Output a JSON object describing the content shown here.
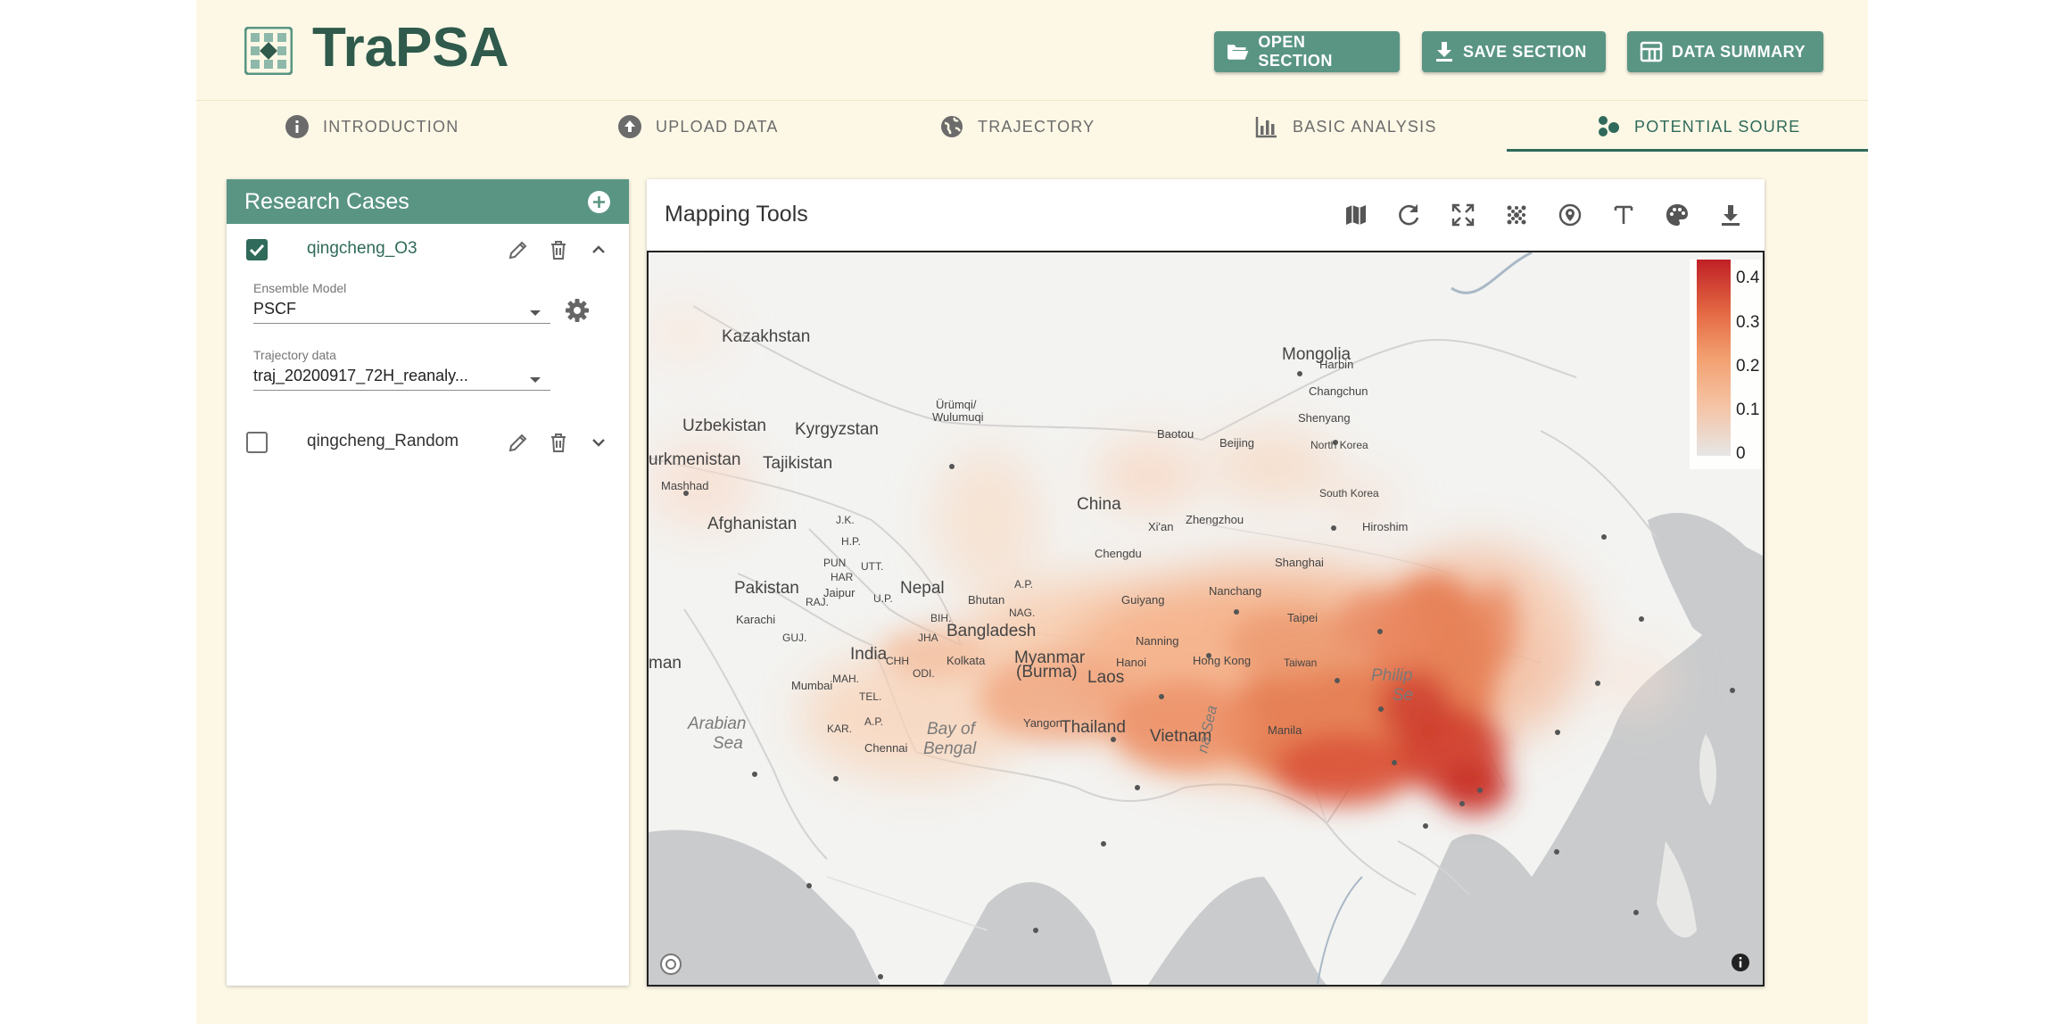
{
  "app": {
    "title": "TraPSA"
  },
  "header": {
    "buttons": [
      {
        "label": "OPEN SECTION",
        "icon": "folder-open-icon"
      },
      {
        "label": "SAVE SECTION",
        "icon": "download-icon"
      },
      {
        "label": "DATA SUMMARY",
        "icon": "table-icon"
      }
    ]
  },
  "tabs": [
    {
      "label": "INTRODUCTION",
      "icon": "info-icon"
    },
    {
      "label": "UPLOAD DATA",
      "icon": "upload-icon"
    },
    {
      "label": "TRAJECTORY",
      "icon": "globe-icon"
    },
    {
      "label": "BASIC ANALYSIS",
      "icon": "bar-chart-icon"
    },
    {
      "label": "POTENTIAL SOURE",
      "icon": "bubbles-icon",
      "active": true
    }
  ],
  "research": {
    "title": "Research Cases",
    "cases": [
      {
        "name": "qingcheng_O3",
        "checked": true,
        "expanded": true,
        "ensemble_label": "Ensemble Model",
        "ensemble_value": "PSCF",
        "trajectory_label": "Trajectory data",
        "trajectory_value": "traj_20200917_72H_reanaly..."
      },
      {
        "name": "qingcheng_Random",
        "checked": false,
        "expanded": false
      }
    ]
  },
  "mapping": {
    "title": "Mapping Tools",
    "tools": [
      "map-icon",
      "refresh-icon",
      "fullscreen-icon",
      "grid-dots-icon",
      "location-pin-icon",
      "text-icon",
      "palette-icon",
      "download-icon"
    ],
    "legend": {
      "ticks": [
        "0.4",
        "0.3",
        "0.2",
        "0.1",
        "0"
      ],
      "colors": {
        "low": "#e6e6e6",
        "high": "#c02025"
      }
    },
    "labels": {
      "kazakhstan": "Kazakhstan",
      "mongolia": "Mongolia",
      "uzbekistan": "Uzbekistan",
      "kyrgyzstan": "Kyrgyzstan",
      "turkmenistan": "urkmenistan",
      "tajikistan": "Tajikistan",
      "mashhad": "Mashhad",
      "afghanistan": "Afghanistan",
      "pakistan": "Pakistan",
      "india": "India",
      "nepal": "Nepal",
      "bangladesh": "Bangladesh",
      "myanmar": "Myanmar",
      "myanmar2": "(Burma)",
      "laos": "Laos",
      "thailand": "Thailand",
      "vietnam": "Vietnam",
      "china": "China",
      "urumqi": "Ürümqi/",
      "urumqi2": "Wulumuqi",
      "baotou": "Baotou",
      "beijing": "Beijing",
      "harbin": "Harbin",
      "changchun": "Changchun",
      "shenyang": "Shenyang",
      "north_korea": "North Korea",
      "south_korea": "South Korea",
      "zhengzhou": "Zhengzhou",
      "xian": "Xi'an",
      "chengdu": "Chengdu",
      "guiyang": "Guiyang",
      "nanchang": "Nanchang",
      "shanghai": "Shanghai",
      "taipei": "Taipei",
      "taiwan": "Taiwan",
      "nanning": "Nanning",
      "hong_kong": "Hong Kong",
      "hanoi": "Hanoi",
      "bhutan": "Bhutan",
      "jaipur": "Jaipur",
      "karachi": "Karachi",
      "kolkata": "Kolkata",
      "mumbai": "Mumbai",
      "yangon": "Yangon",
      "chennai": "Chennai",
      "manila": "Manila",
      "hiroshima": "Hiroshim",
      "arabian": "Arabian",
      "sea": "Sea",
      "bay_of": "Bay of",
      "bengal": "Bengal",
      "philip": "Philip",
      "se": "Se",
      "man": "man",
      "jk": "J.K.",
      "hp": "H.P.",
      "pun": "PUN",
      "har": "HAR",
      "utt": "UTT.",
      "raj": "RAJ.",
      "up": "U.P.",
      "bih": "BIH.",
      "jha": "JHA",
      "ap": "A.P.",
      "nag": "NAG.",
      "guj": "GUJ.",
      "mah": "MAH.",
      "chh": "CHH",
      "odi": "ODI.",
      "tel": "TEL.",
      "kar": "KAR.",
      "ap2": "A.P.",
      "south_china_sea": "na Sea"
    }
  }
}
